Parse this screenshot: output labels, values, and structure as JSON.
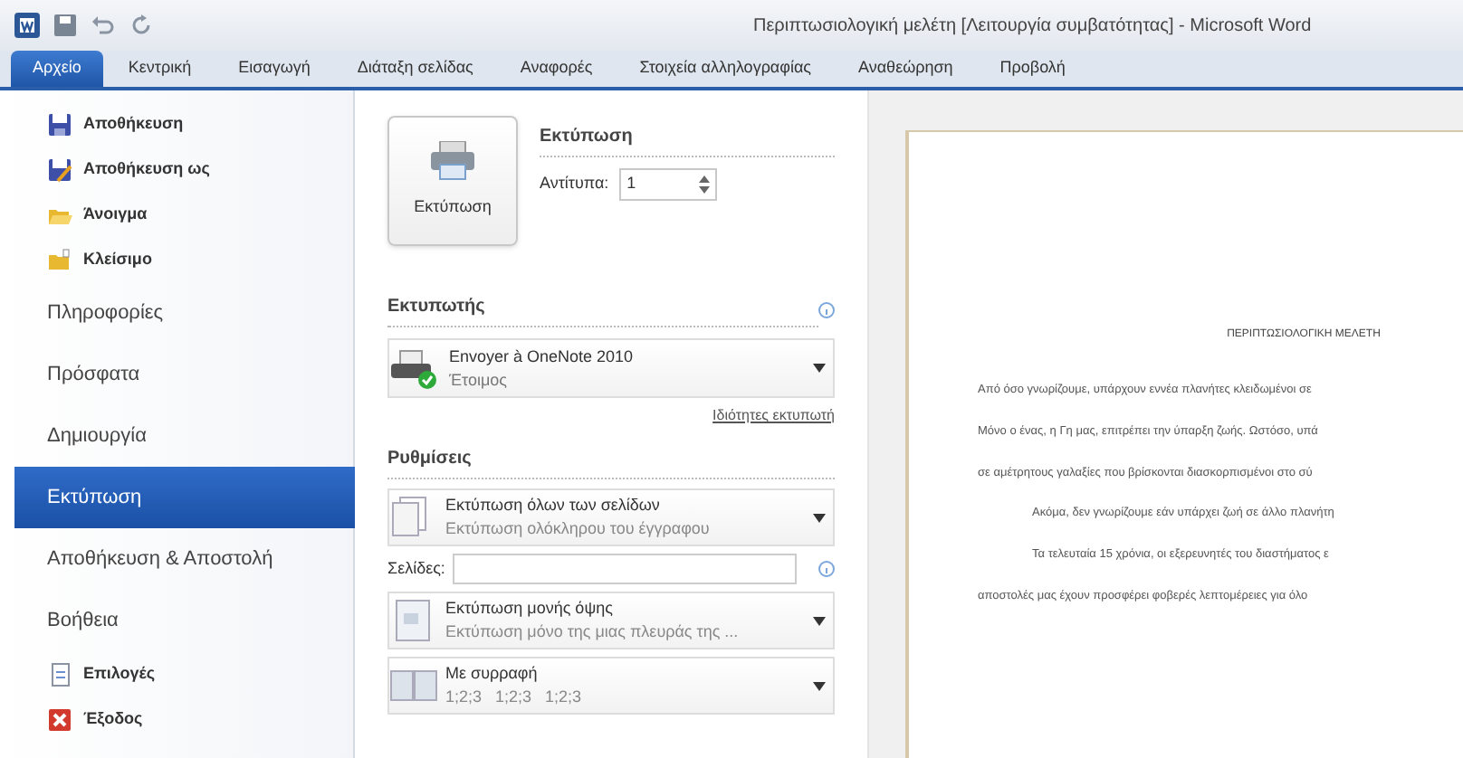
{
  "window": {
    "title": "Περιπτωσιολογική μελέτη [Λειτουργία συμβατότητας] - Microsoft Word"
  },
  "ribbon_tabs": [
    {
      "label": "Αρχείο",
      "selected": true
    },
    {
      "label": "Κεντρική",
      "selected": false
    },
    {
      "label": "Εισαγωγή",
      "selected": false
    },
    {
      "label": "Διάταξη σελίδας",
      "selected": false
    },
    {
      "label": "Αναφορές",
      "selected": false
    },
    {
      "label": "Στοιχεία αλληλογραφίας",
      "selected": false
    },
    {
      "label": "Αναθεώρηση",
      "selected": false
    },
    {
      "label": "Προβολή",
      "selected": false
    }
  ],
  "sidebar": {
    "items": [
      {
        "label": "Αποθήκευση",
        "kind": "command",
        "selected": false
      },
      {
        "label": "Αποθήκευση ως",
        "kind": "command",
        "selected": false
      },
      {
        "label": "Άνοιγμα",
        "kind": "command",
        "selected": false
      },
      {
        "label": "Κλείσιμο",
        "kind": "command",
        "selected": false
      },
      {
        "label": "Πληροφορίες",
        "kind": "section",
        "selected": false
      },
      {
        "label": "Πρόσφατα",
        "kind": "section",
        "selected": false
      },
      {
        "label": "Δημιουργία",
        "kind": "section",
        "selected": false
      },
      {
        "label": "Εκτύπωση",
        "kind": "section",
        "selected": true
      },
      {
        "label": "Αποθήκευση & Αποστολή",
        "kind": "section",
        "selected": false
      },
      {
        "label": "Βοήθεια",
        "kind": "section",
        "selected": false
      },
      {
        "label": "Επιλογές",
        "kind": "command",
        "selected": false
      },
      {
        "label": "Έξοδος",
        "kind": "command",
        "selected": false
      }
    ]
  },
  "print": {
    "button": "Εκτύπωση",
    "heading": "Εκτύπωση",
    "copies_label": "Αντίτυπα:",
    "copies": "1"
  },
  "printer": {
    "heading": "Εκτυπωτής",
    "name": "Envoyer à OneNote 2010",
    "status": "Έτοιμος",
    "properties_link": "Ιδιότητες εκτυπωτή"
  },
  "settings": {
    "heading": "Ρυθμίσεις",
    "options": [
      {
        "kind": "dropdown",
        "title": "Εκτύπωση όλων των σελίδων",
        "subtitle": "Εκτύπωση ολόκληρου του έγγραφου"
      },
      {
        "kind": "pages",
        "label": "Σελίδες:"
      },
      {
        "kind": "dropdown",
        "title": "Εκτύπωση μονής όψης",
        "subtitle": "Εκτύπωση μόνο της μιας πλευράς της ..."
      },
      {
        "kind": "dropdown",
        "title": "Με συρραφή",
        "subtitle": "1;2;3   1;2;3   1;2;3"
      }
    ]
  },
  "preview": {
    "title": "ΠΕΡΙΠΤΩΣΙΟΛΟΓΙΚΗ ΜΕΛΕΤΗ",
    "paragraphs": [
      "Από όσο γνωρίζουμε, υπάρχουν εννέα πλανήτες κλειδωμένοι σε",
      "Μόνο ο ένας, η Γη μας, επιτρέπει την ύπαρξη ζωής. Ωστόσο, υπά",
      "σε αμέτρητους γαλαξίες που βρίσκονται διασκορπισμένοι στο σύ",
      "Ακόμα, δεν γνωρίζουμε εάν υπάρχει ζωή σε άλλο πλανήτη",
      "Τα τελευταία 15 χρόνια, οι εξερευνητές του διαστήματος ε",
      "αποστολές μας έχουν προσφέρει φοβερές λεπτομέρειες για όλο"
    ]
  }
}
